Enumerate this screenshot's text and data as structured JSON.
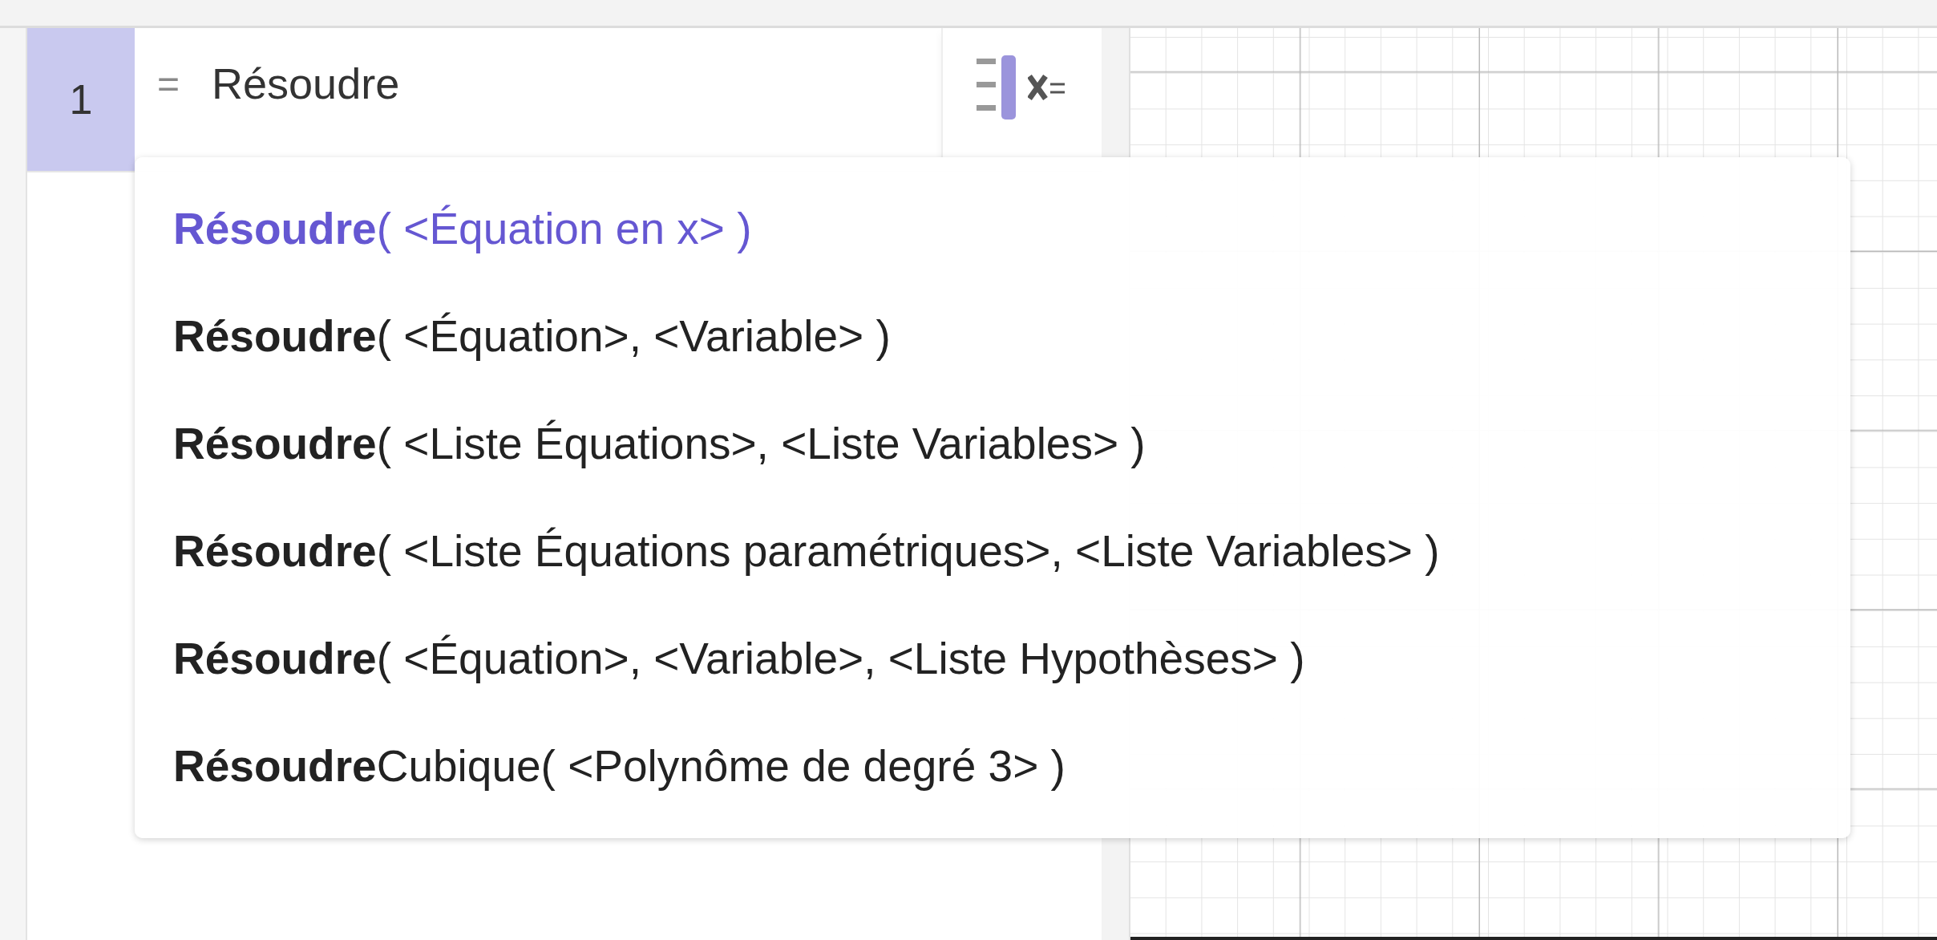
{
  "algebra": {
    "rows": [
      {
        "number": "1",
        "prefix": "=",
        "value": "Résoudre",
        "selected": true
      }
    ]
  },
  "suggestions": [
    {
      "text": "**Résoudre**( <Équation en x> )",
      "selected": true
    },
    {
      "text": "**Résoudre**( <Équation>, <Variable> )",
      "selected": false
    },
    {
      "text": "**Résoudre**( <Liste Équations>, <Liste Variables> )",
      "selected": false
    },
    {
      "text": "**Résoudre**( <Liste Équations paramétriques>, <Liste Variables> )",
      "selected": false
    },
    {
      "text": "**Résoudre**( <Équation>, <Variable>, <Liste Hypothèses> )",
      "selected": false
    },
    {
      "text": "**Résoudre**Cubique( <Polynôme de degré 3> )",
      "selected": false
    }
  ]
}
